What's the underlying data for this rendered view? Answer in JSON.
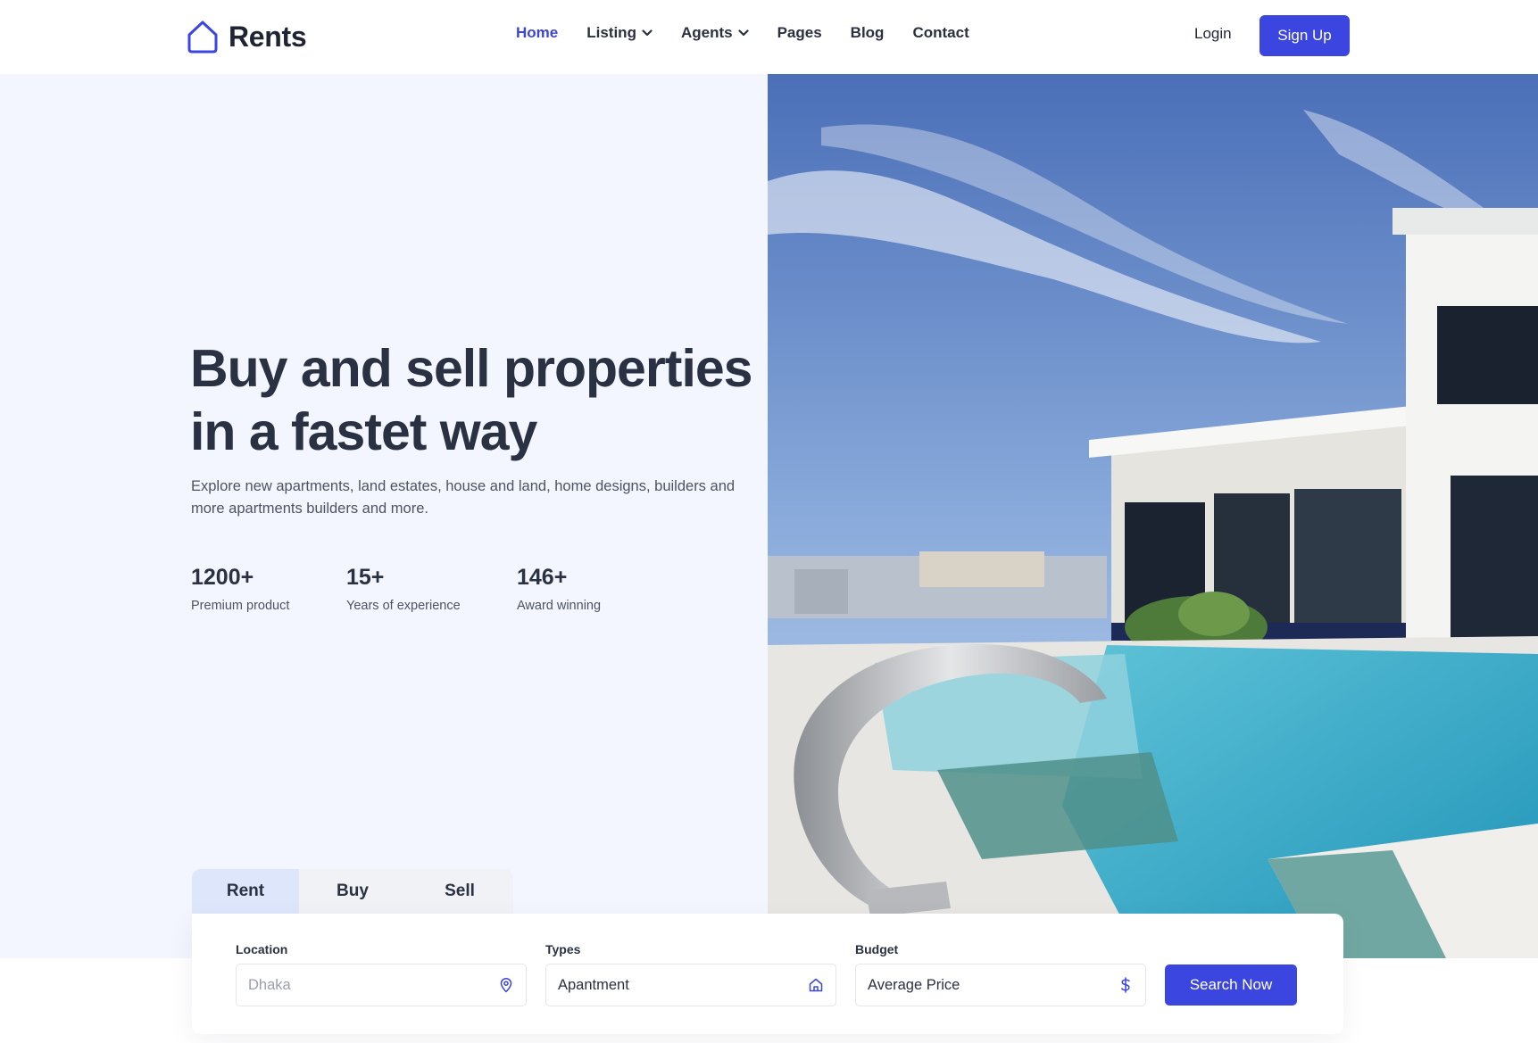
{
  "brand": {
    "name": "Rents",
    "icon": "house-outline-icon",
    "accent": "#3b45e0"
  },
  "nav": {
    "items": [
      {
        "label": "Home",
        "active": true
      },
      {
        "label": "Listing",
        "dropdown": true
      },
      {
        "label": "Agents",
        "dropdown": true
      },
      {
        "label": "Pages"
      },
      {
        "label": "Blog"
      },
      {
        "label": "Contact"
      }
    ],
    "login_label": "Login",
    "signup_label": "Sign Up"
  },
  "hero": {
    "title_line1": "Buy and sell properties",
    "title_line2": "in a fastet way",
    "subtitle": "Explore new apartments, land estates, house and land, home designs, builders and more apartments builders and more.",
    "stats": [
      {
        "value": "1200+",
        "label": "Premium product"
      },
      {
        "value": "15+",
        "label": "Years of experience"
      },
      {
        "value": "146+",
        "label": "Award winning"
      }
    ],
    "image": "modern-villa-with-pool-photo"
  },
  "search": {
    "tabs": [
      {
        "label": "Rent",
        "active": true
      },
      {
        "label": "Buy"
      },
      {
        "label": "Sell"
      }
    ],
    "location": {
      "label": "Location",
      "placeholder": "Dhaka",
      "icon": "map-pin-icon"
    },
    "types": {
      "label": "Types",
      "value": "Apantment",
      "icon": "home-icon"
    },
    "budget": {
      "label": "Budget",
      "value": "Average Price",
      "icon": "dollar-icon"
    },
    "submit_label": "Search Now"
  }
}
